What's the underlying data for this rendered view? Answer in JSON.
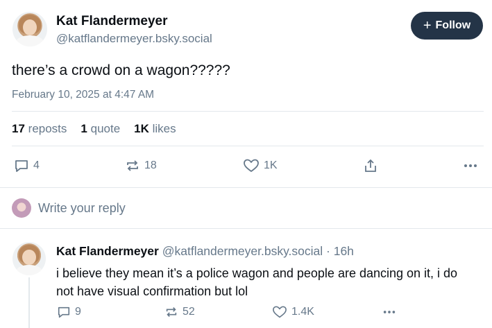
{
  "post": {
    "author_name": "Kat Flandermeyer",
    "author_handle": "@katflandermeyer.bsky.social",
    "follow_label": "Follow",
    "text": "there’s a crowd on a wagon?????",
    "timestamp": "February 10, 2025 at 4:47 AM",
    "stats": {
      "reposts_count": "17",
      "reposts_label": "reposts",
      "quotes_count": "1",
      "quotes_label": "quote",
      "likes_count": "1K",
      "likes_label": "likes"
    },
    "actions": {
      "replies": "4",
      "reposts": "18",
      "likes": "1K"
    }
  },
  "reply_box": {
    "placeholder": "Write your reply"
  },
  "reply": {
    "author_name": "Kat Flandermeyer",
    "author_handle": "@katflandermeyer.bsky.social",
    "time": "· 16h",
    "text": "i believe they mean it’s a police wagon and people are dancing on it, i do not have visual confirmation but lol",
    "actions": {
      "replies": "9",
      "reposts": "52",
      "likes": "1.4K"
    }
  },
  "icons": {
    "comment": "speech-bubble-icon",
    "repost": "repost-arrows-icon",
    "like": "heart-icon",
    "share": "share-icon",
    "more": "ellipsis-icon",
    "follow": "plus-icon"
  },
  "colors": {
    "follow_bg": "#243447",
    "muted": "#66788a",
    "divider": "#e3e8ec"
  }
}
